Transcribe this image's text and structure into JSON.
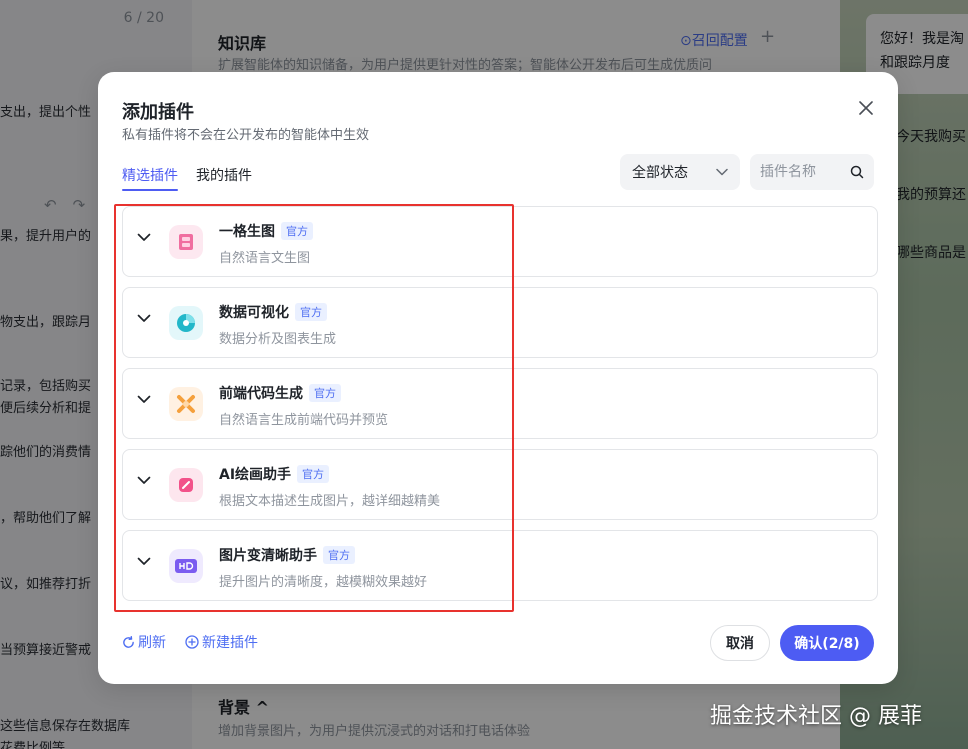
{
  "background": {
    "left_panel": {
      "counter": "6 / 20",
      "lines": [
        {
          "text": "支出，提出个性"
        },
        {
          "text": "果，提升用户的"
        },
        {
          "text": "物支出，跟踪月"
        },
        {
          "text": "记录，包括购买"
        },
        {
          "text": "便后续分析和提"
        },
        {
          "text": "踪他们的消费情"
        },
        {
          "text": "，帮助他们了解"
        },
        {
          "text": "议，如推荐打折"
        },
        {
          "text": "当预算接近警戒"
        },
        {
          "text": "这些信息保存在数据库"
        },
        {
          "text": "花费比例等"
        }
      ]
    },
    "knowledge": {
      "title": "知识库",
      "description": "扩展智能体的知识储备，为用户提供更针对性的答案；智能体公开发布后可生成优质问",
      "recall_config": "召回配置",
      "add": "+"
    },
    "background_section": {
      "title": "背景 ^",
      "description": "增加背景图片，为用户提供沉浸式的对话和打电话体验"
    },
    "chat": {
      "greeting_lines": [
        "您好！我是淘",
        "和跟踪月度"
      ],
      "questions": [
        "今天我购买",
        "我的预算还",
        "哪些商品是"
      ]
    }
  },
  "modal": {
    "title": "添加插件",
    "subtitle": "私有插件将不会在公开发布的智能体中生效",
    "tabs": [
      {
        "label": "精选插件",
        "active": true
      },
      {
        "label": "我的插件",
        "active": false
      }
    ],
    "status_select": {
      "value": "全部状态"
    },
    "search": {
      "placeholder": "插件名称"
    },
    "plugins": [
      {
        "name": "一格生图",
        "badge": "官方",
        "description": "自然语言文生图",
        "icon": "image-gen-icon",
        "color": "#f06ea0"
      },
      {
        "name": "数据可视化",
        "badge": "官方",
        "description": "数据分析及图表生成",
        "icon": "data-viz-icon",
        "color": "#23b7c9"
      },
      {
        "name": "前端代码生成",
        "badge": "官方",
        "description": "自然语言生成前端代码并预览",
        "icon": "code-gen-icon",
        "color": "#f5a03c"
      },
      {
        "name": "AI绘画助手",
        "badge": "官方",
        "description": "根据文本描述生成图片，越详细越精美",
        "icon": "ai-paint-icon",
        "color": "#f2528a"
      },
      {
        "name": "图片变清晰助手",
        "badge": "官方",
        "description": "提升图片的清晰度，越模糊效果越好",
        "icon": "hd-image-icon",
        "color": "#7b5cf0"
      }
    ],
    "footer": {
      "refresh": "刷新",
      "new_plugin": "新建插件",
      "cancel": "取消",
      "confirm": "确认(2/8)"
    }
  },
  "watermark": "掘金技术社区 @ 展菲",
  "colors": {
    "accent": "#4e5cf2",
    "link": "#4e6ef2",
    "highlight": "#e8322e"
  }
}
